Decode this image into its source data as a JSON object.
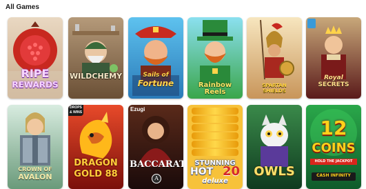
{
  "section": {
    "title": "All Games"
  },
  "games": [
    {
      "title_top": "RIPE",
      "title_bottom": "REWARDS",
      "colors": {
        "bg": "#c23a2a",
        "text": "#f5d7f7",
        "accent": "#a04bd8"
      }
    },
    {
      "title": "WILDCHEMY",
      "colors": {
        "bg": "#8a6b4a",
        "text": "#f6e8c8"
      }
    },
    {
      "title_top": "Sails of",
      "title_bottom": "Fortune",
      "colors": {
        "bg": "#3aa6df",
        "text": "#ffd34a"
      }
    },
    {
      "title": "Rainbow Reels",
      "colors": {
        "bg": "#5bc06a",
        "text": "#ffe46a"
      }
    },
    {
      "title_top": "SPARTAN",
      "title_bottom": "SHIELDS",
      "colors": {
        "bg": "#e8c88a",
        "text": "#ffd23a"
      }
    },
    {
      "title_top": "Royal",
      "title_bottom": "SECRETS",
      "colors": {
        "bg": "#8a2b2b",
        "text": "#ffe08a"
      }
    },
    {
      "title_top": "CROWN OF",
      "title_bottom": "AVALON",
      "colors": {
        "bg": "#b8d6c2",
        "text": "#f2e8a8"
      }
    },
    {
      "title_top": "DRAGON",
      "title_bottom": "GOLD 88",
      "badge": "DROPS & WINS",
      "colors": {
        "bg": "#b8261c",
        "text": "#ffcf3a"
      }
    },
    {
      "title": "BACCARAT",
      "badge": "Ezugi",
      "logo_letter": "A",
      "colors": {
        "bg": "#6a1a1a",
        "text": "#ffffff"
      }
    },
    {
      "title_top": "STUNNING",
      "title_mid": "HOT",
      "title_num": "20",
      "title_bottom": "deluxe",
      "colors": {
        "bg": "#f2b21a",
        "text": "#ffffff",
        "accent": "#d62a2a"
      }
    },
    {
      "title": "OWLS",
      "colors": {
        "bg": "#1f5a3a",
        "text": "#ffe06a"
      }
    },
    {
      "title_num": "12",
      "title_top": "COINS",
      "title_mid": "HOLD THE JACKPOT",
      "title_bottom": "CASH INFINITY",
      "colors": {
        "bg": "#1b8a3a",
        "text": "#ffd21a",
        "accent": "#d9261c"
      }
    }
  ]
}
